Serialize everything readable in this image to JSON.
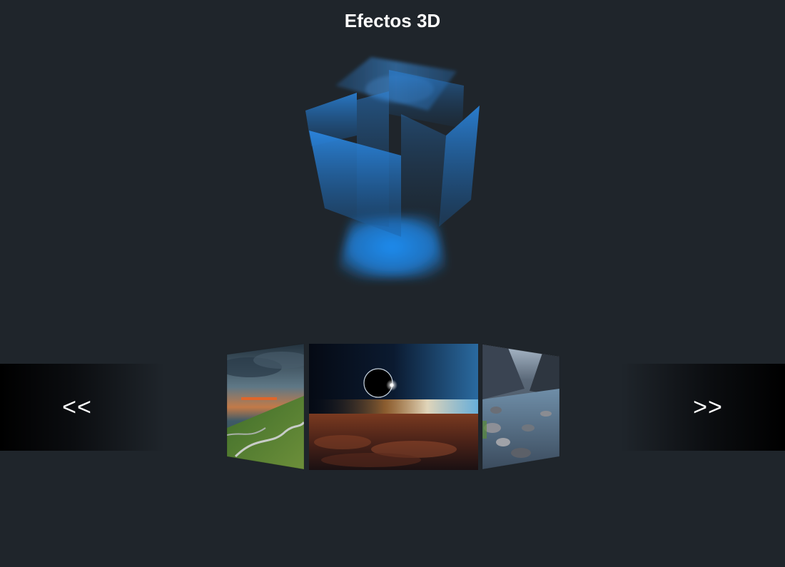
{
  "page": {
    "title": "Efectos 3D"
  },
  "cube": {
    "icon": "3d-cube-icon",
    "color": "#1e7fd8"
  },
  "carousel": {
    "prev_label": "<<",
    "next_label": ">>",
    "slides": [
      {
        "icon": "coastal-road-landscape-image"
      },
      {
        "icon": "eclipse-over-clouds-image"
      },
      {
        "icon": "mountain-river-valley-image"
      }
    ]
  }
}
